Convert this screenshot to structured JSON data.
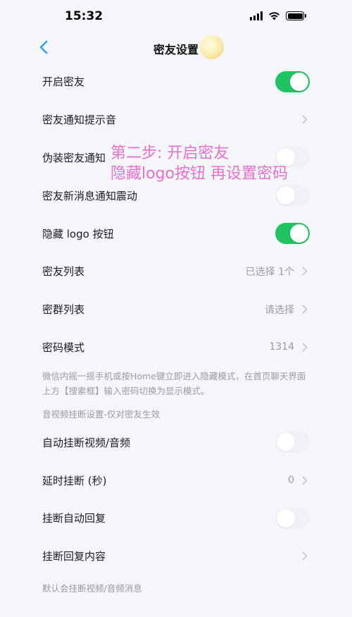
{
  "status_bar": {
    "time": "15:32"
  },
  "nav": {
    "title": "密友设置"
  },
  "rows_a": [
    {
      "label": "开启密友",
      "kind": "toggle",
      "on": true
    },
    {
      "label": "密友通知提示音",
      "kind": "chevron"
    },
    {
      "label": "伪装密友通知",
      "kind": "toggle",
      "on": false
    },
    {
      "label": "密友新消息通知震动",
      "kind": "toggle",
      "on": false
    },
    {
      "label": "隐藏 logo 按钮",
      "kind": "toggle",
      "on": true
    },
    {
      "label": "密友列表",
      "kind": "chevron",
      "value": "已选择 1个"
    },
    {
      "label": "密群列表",
      "kind": "chevron",
      "value": "请选择"
    },
    {
      "label": "密码模式",
      "kind": "chevron",
      "value": "1314"
    }
  ],
  "note_password": "微信内摇一摇手机或按Home键立即进入隐藏模式，在首页聊天界面上方【搜索框】输入密码切换为显示模式。",
  "section_av": "音视频挂断设置-仅对密友生效",
  "rows_b": [
    {
      "label": "自动挂断视频/音频",
      "kind": "toggle",
      "on": false
    },
    {
      "label": "延时挂断 (秒)",
      "kind": "chevron",
      "value": "0"
    },
    {
      "label": "挂断自动回复",
      "kind": "toggle",
      "on": false
    },
    {
      "label": "挂断回复内容",
      "kind": "chevron"
    }
  ],
  "note_hangup": "默认会挂断视频/音频消息",
  "overlay": {
    "line1": "第二步: 开启密友",
    "line2": "隐藏logo按钮 再设置密码"
  },
  "colors": {
    "toggle_on": "#21c463",
    "accent": "#2aa4f4",
    "overlay": "#e86fd0"
  }
}
